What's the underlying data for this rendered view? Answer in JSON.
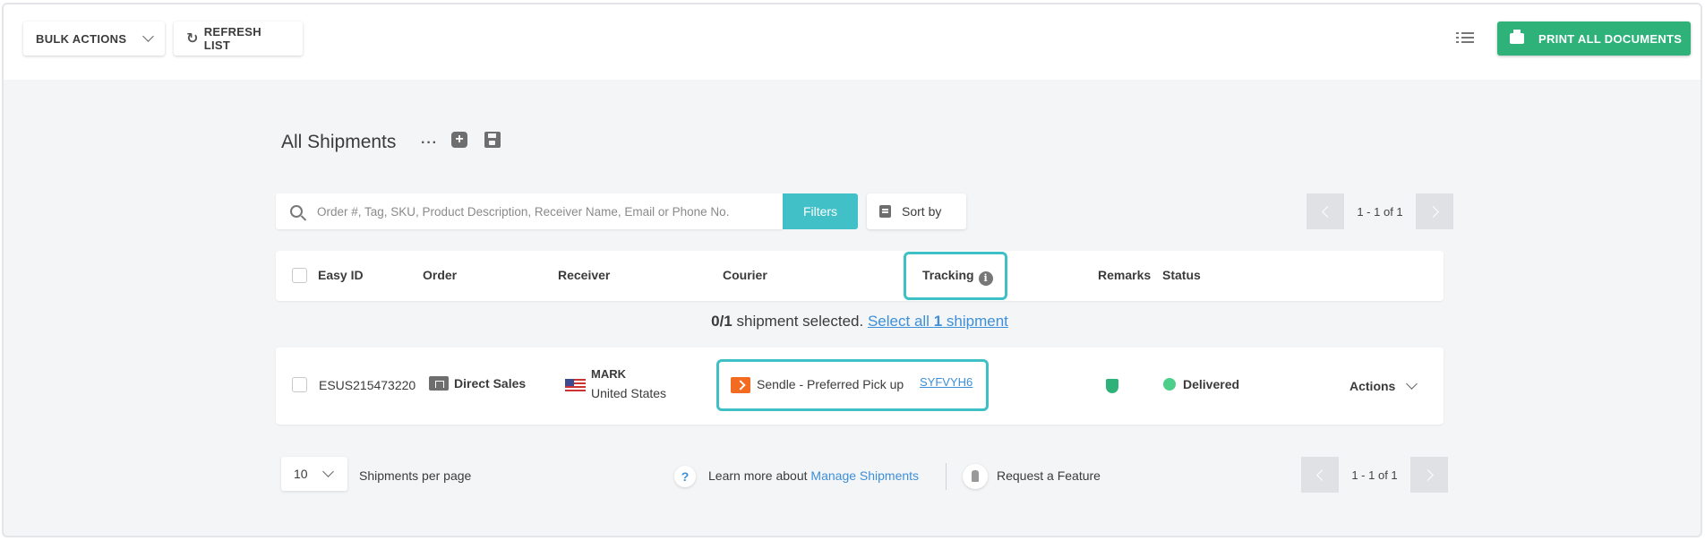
{
  "toolbar": {
    "bulk_actions_label": "BULK ACTIONS",
    "refresh_label": "REFRESH LIST",
    "print_label": "PRINT ALL DOCUMENTS",
    "accent_color": "#2eb27a"
  },
  "page": {
    "title": "All Shipments"
  },
  "search": {
    "placeholder": "Order #, Tag, SKU, Product Description, Receiver Name, Email or Phone No.",
    "value": "",
    "filters_label": "Filters",
    "sort_label": "Sort by"
  },
  "pagination": {
    "top_text": "1 - 1 of 1",
    "bottom_text": "1 - 1 of 1"
  },
  "table": {
    "headers": {
      "easy_id": "Easy ID",
      "order": "Order",
      "receiver": "Receiver",
      "courier": "Courier",
      "tracking": "Tracking",
      "remarks": "Remarks",
      "status": "Status"
    },
    "selection": {
      "count": "0/1",
      "text": "shipment selected.",
      "select_all_prefix": "Select all",
      "select_all_count": "1",
      "select_all_suffix": "shipment"
    },
    "rows": [
      {
        "easy_id": "ESUS215473220",
        "order": "Direct Sales",
        "receiver_name": "MARK",
        "receiver_country": "United States",
        "courier": "Sendle - Preferred Pick up",
        "tracking": "SYFVYH6",
        "status": "Delivered",
        "status_color": "#4dcf8a",
        "actions_label": "Actions"
      }
    ]
  },
  "footer": {
    "per_page_value": "10",
    "per_page_label": "Shipments per page",
    "learn_prefix": "Learn more about",
    "learn_link": "Manage Shipments",
    "feature_label": "Request a Feature"
  },
  "icons": {
    "refresh": "refresh-icon",
    "print": "printer-icon",
    "search": "search-icon",
    "info": "info-icon",
    "help": "question-icon"
  }
}
